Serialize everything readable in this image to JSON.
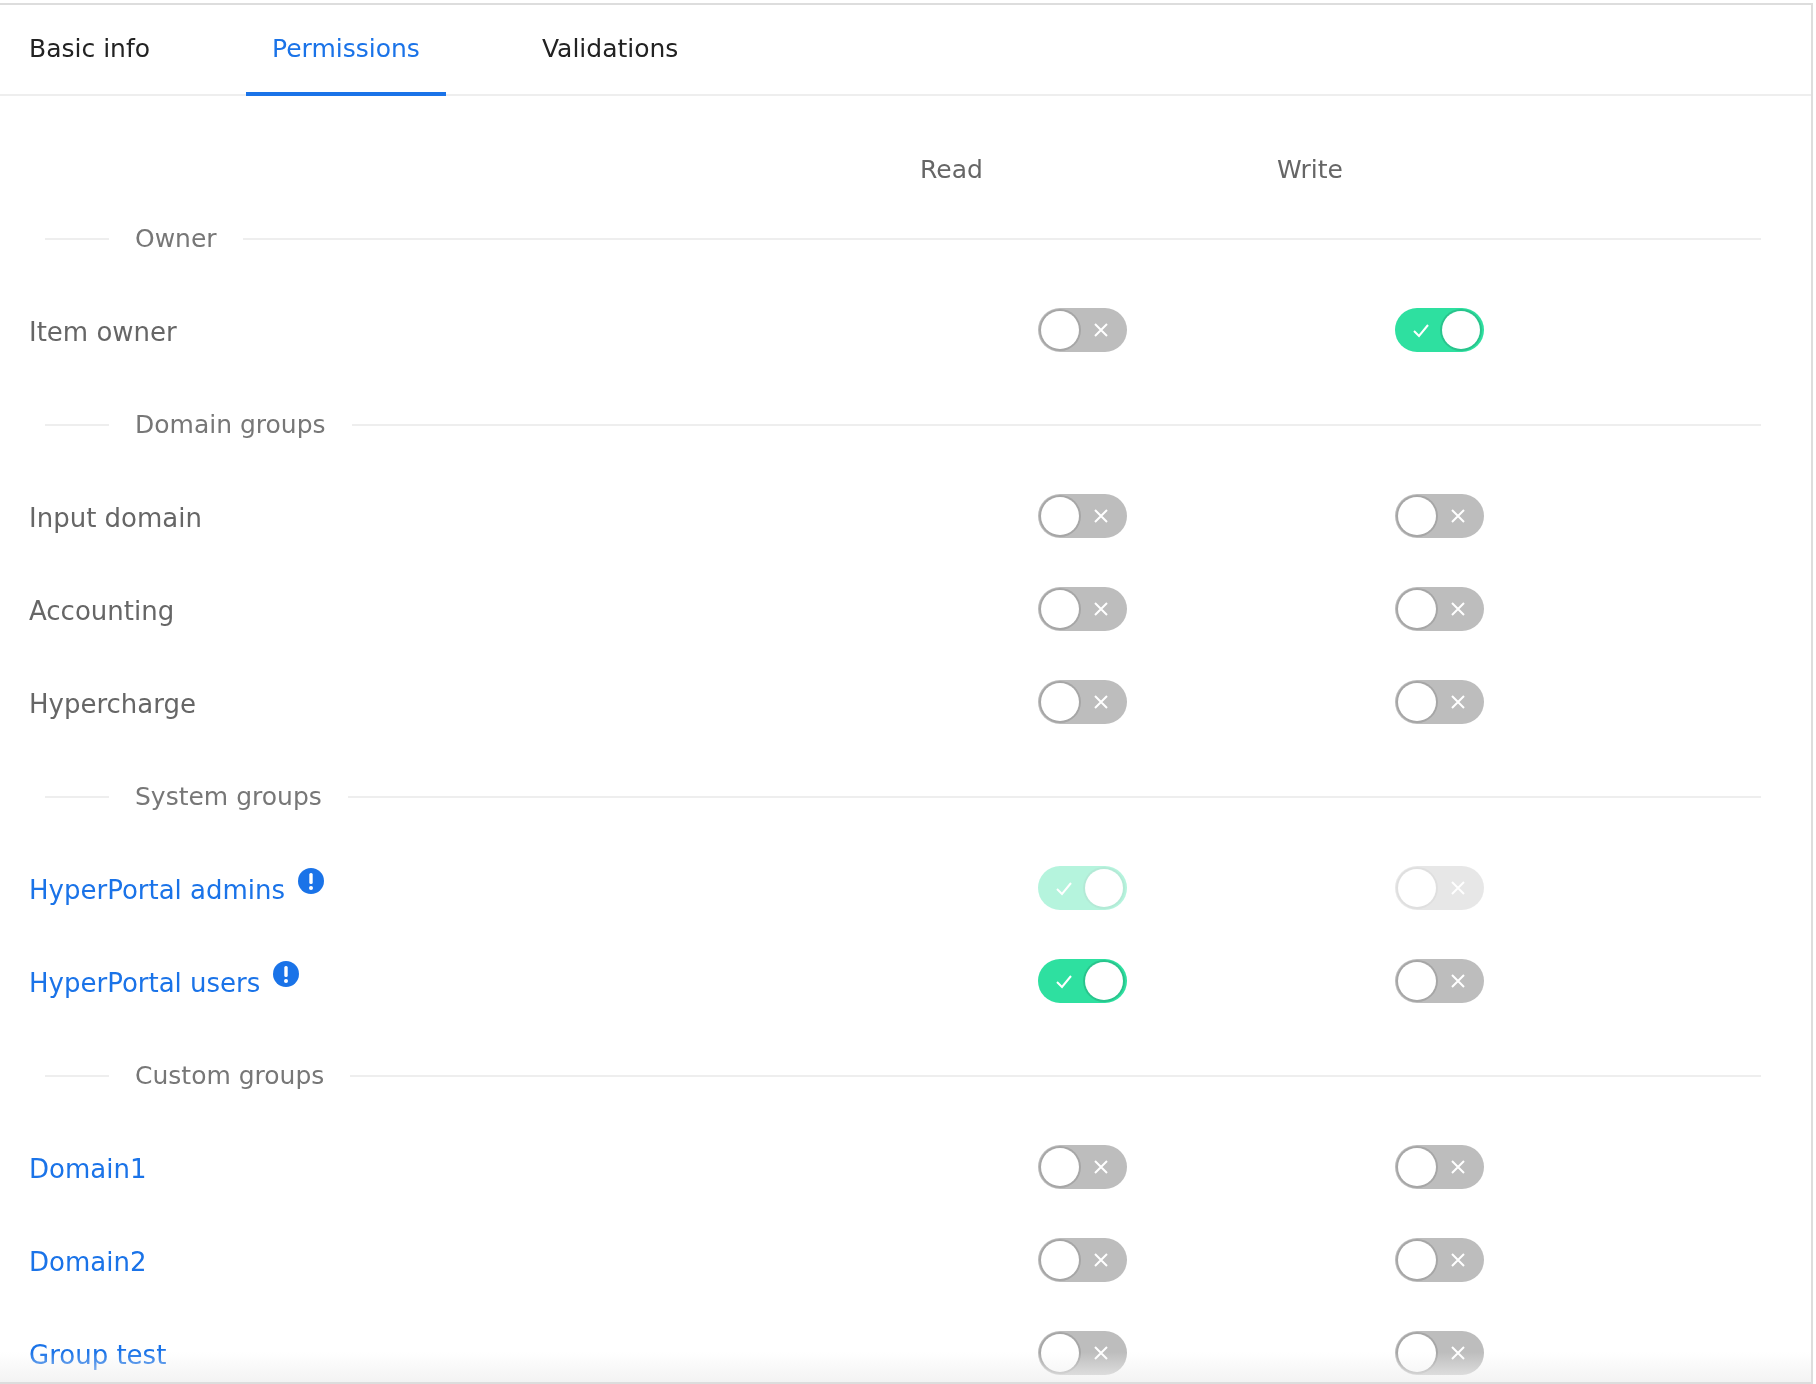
{
  "tabs": [
    {
      "label": "Basic info",
      "selected": false
    },
    {
      "label": "Permissions",
      "selected": true
    },
    {
      "label": "Validations",
      "selected": false
    }
  ],
  "columns": [
    "Read",
    "Write"
  ],
  "sections": [
    {
      "title": "Owner",
      "rows": [
        {
          "label": "Item owner",
          "linked": false,
          "warning": false,
          "disabled": false,
          "read": false,
          "write": true
        }
      ]
    },
    {
      "title": "Domain groups",
      "rows": [
        {
          "label": "Input domain",
          "linked": false,
          "warning": false,
          "disabled": false,
          "read": false,
          "write": false
        },
        {
          "label": "Accounting",
          "linked": false,
          "warning": false,
          "disabled": false,
          "read": false,
          "write": false
        },
        {
          "label": "Hypercharge",
          "linked": false,
          "warning": false,
          "disabled": false,
          "read": false,
          "write": false
        }
      ]
    },
    {
      "title": "System groups",
      "rows": [
        {
          "label": "HyperPortal admins",
          "linked": true,
          "warning": true,
          "disabled": true,
          "read": true,
          "write": false
        },
        {
          "label": "HyperPortal users",
          "linked": true,
          "warning": true,
          "disabled": false,
          "read": true,
          "write": false
        }
      ]
    },
    {
      "title": "Custom groups",
      "rows": [
        {
          "label": "Domain1",
          "linked": true,
          "warning": false,
          "disabled": false,
          "read": false,
          "write": false
        },
        {
          "label": "Domain2",
          "linked": true,
          "warning": false,
          "disabled": false,
          "read": false,
          "write": false
        },
        {
          "label": "Group test",
          "linked": true,
          "warning": false,
          "disabled": false,
          "read": false,
          "write": false
        }
      ]
    }
  ]
}
